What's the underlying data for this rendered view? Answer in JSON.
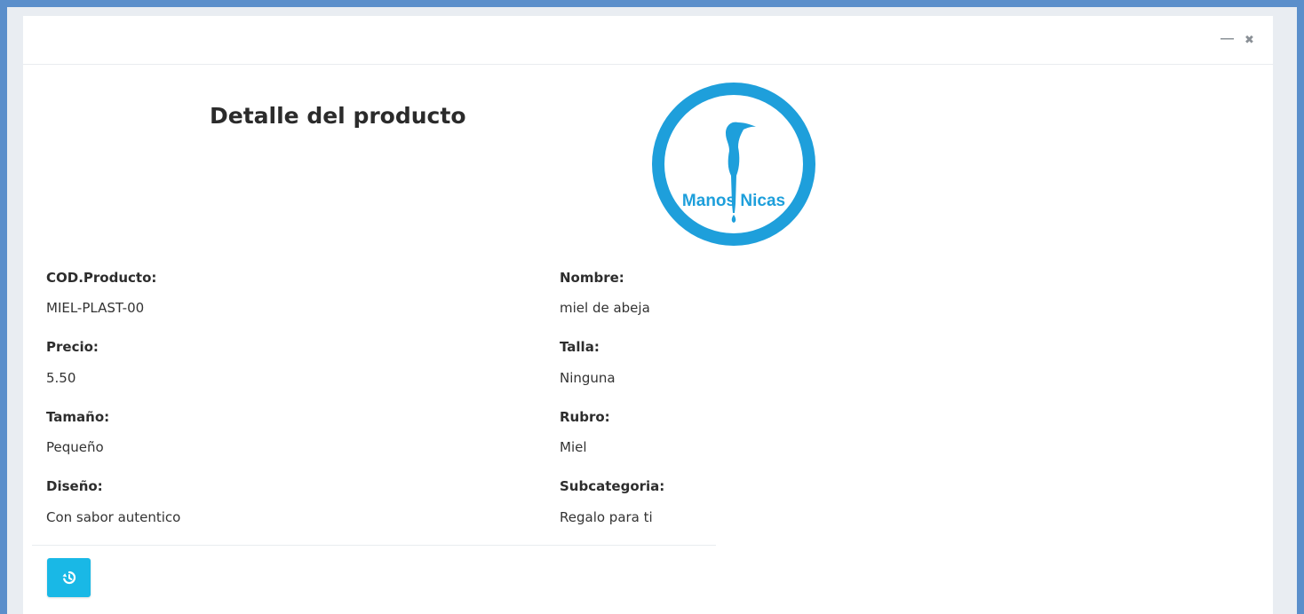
{
  "window": {
    "minimize_glyph": "—",
    "close_glyph": "✖"
  },
  "header": {
    "title": "Detalle del producto",
    "logo_text": "Manos Nicas",
    "logo_color": "#1e9fdb"
  },
  "fields": {
    "cod_label": "COD.Producto:",
    "cod_value": "MIEL-PLAST-00",
    "nombre_label": "Nombre:",
    "nombre_value": "miel de abeja",
    "precio_label": "Precio:",
    "precio_value": "5.50",
    "talla_label": "Talla:",
    "talla_value": "Ninguna",
    "tamano_label": "Tamaño:",
    "tamano_value": "Pequeño",
    "rubro_label": "Rubro:",
    "rubro_value": "Miel",
    "diseno_label": "Diseño:",
    "diseno_value": "Con sabor autentico",
    "subcategoria_label": "Subcategoria:",
    "subcategoria_value": "Regalo para ti"
  },
  "footer": {
    "back_button_icon": "history-icon",
    "back_button_color": "#19b8e6"
  }
}
